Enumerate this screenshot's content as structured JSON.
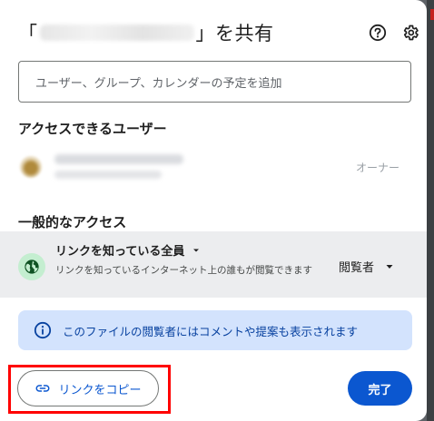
{
  "dialog": {
    "title_open": "「",
    "title_close": "」を共有",
    "add_placeholder": "ユーザー、グループ、カレンダーの予定を追加",
    "people_section_title": "アクセスできるユーザー",
    "owner_role": "オーナー",
    "general_access_title": "一般的なアクセス",
    "access_option": "リンクを知っている全員",
    "access_description": "リンクを知っているインターネット上の誰もが閲覧できます",
    "role_option": "閲覧者",
    "info_text": "このファイルの閲覧者にはコメントや提案も表示されます",
    "copy_link_label": "リンクをコピー",
    "done_label": "完了"
  },
  "icons": {
    "help": "help-icon",
    "settings": "gear-icon",
    "globe": "globe-icon",
    "info": "info-icon",
    "link": "link-icon",
    "dropdown": "caret-down-icon"
  },
  "colors": {
    "primary": "#0b57d0",
    "info_bg": "#d3e3fd",
    "access_bg": "#ecedef",
    "globe_bg": "#c4eed0",
    "highlight": "#ff0000"
  }
}
